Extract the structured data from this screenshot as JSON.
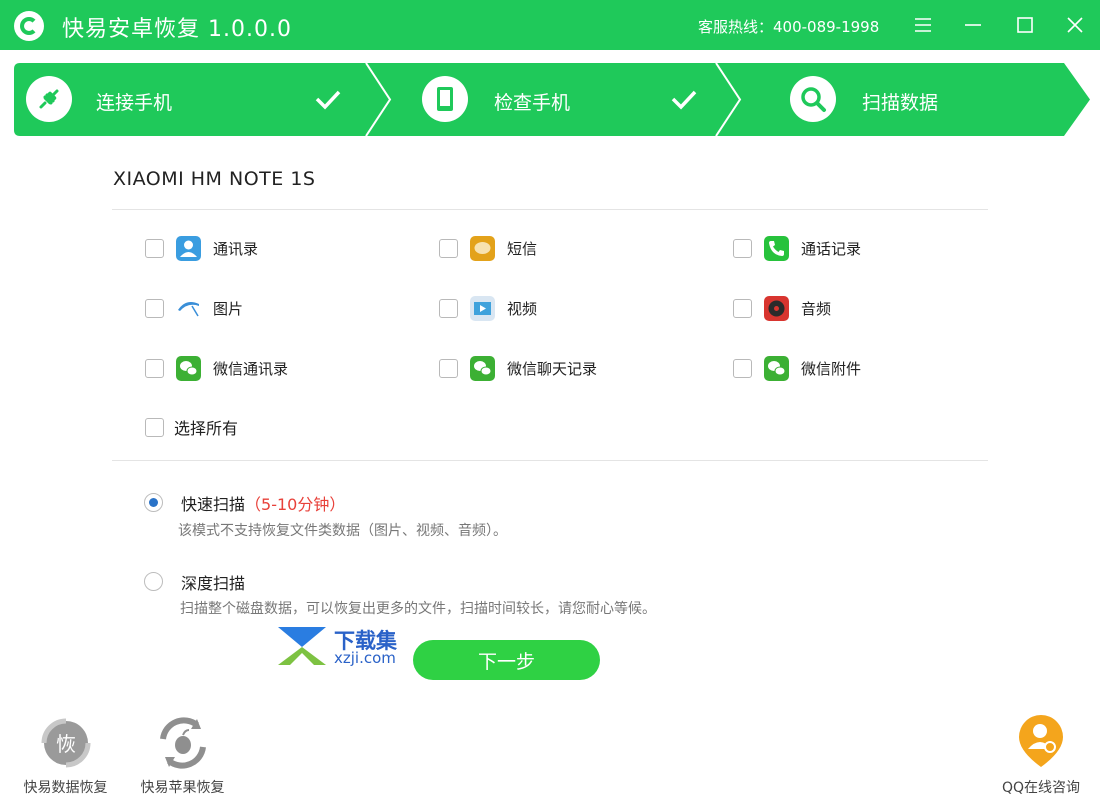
{
  "window": {
    "title": "快易安卓恢复 1.0.0.0",
    "hotline": "客服热线：400-089-1998",
    "brand_color": "#1fc95a"
  },
  "steps": [
    {
      "label": "连接手机",
      "icon": "plug-icon",
      "done": true
    },
    {
      "label": "检查手机",
      "icon": "phone-icon",
      "done": true
    },
    {
      "label": "扫描数据",
      "icon": "search-icon",
      "done": false
    }
  ],
  "device": {
    "name": "XIAOMI HM NOTE 1S"
  },
  "data_types": [
    {
      "label": "通讯录",
      "icon": "contacts-icon",
      "checked": false
    },
    {
      "label": "短信",
      "icon": "sms-icon",
      "checked": false
    },
    {
      "label": "通话记录",
      "icon": "phone-call-icon",
      "checked": false
    },
    {
      "label": "图片",
      "icon": "picture-icon",
      "checked": false
    },
    {
      "label": "视频",
      "icon": "video-icon",
      "checked": false
    },
    {
      "label": "音频",
      "icon": "audio-icon",
      "checked": false
    },
    {
      "label": "微信通讯录",
      "icon": "wechat-icon",
      "checked": false
    },
    {
      "label": "微信聊天记录",
      "icon": "wechat-icon",
      "checked": false
    },
    {
      "label": "微信附件",
      "icon": "wechat-icon",
      "checked": false
    }
  ],
  "select_all": {
    "label": "选择所有",
    "checked": false
  },
  "scan_modes": {
    "quick": {
      "title": "快速扫描",
      "time": "（5-10分钟）",
      "desc": "该模式不支持恢复文件类数据（图片、视频、音频）。",
      "selected": true
    },
    "deep": {
      "title": "深度扫描",
      "desc": "扫描整个磁盘数据，可以恢复出更多的文件，扫描时间较长，请您耐心等候。",
      "selected": false
    }
  },
  "next_button": {
    "label": "下一步"
  },
  "watermark": {
    "name": "下载集",
    "url": "xzji.com"
  },
  "tools": [
    {
      "label": "快易数据恢复",
      "icon": "data-recovery-icon",
      "glyph": "恢"
    },
    {
      "label": "快易苹果恢复",
      "icon": "apple-recovery-icon"
    }
  ],
  "qq": {
    "label": "QQ在线咨询",
    "icon": "qq-support-icon"
  }
}
